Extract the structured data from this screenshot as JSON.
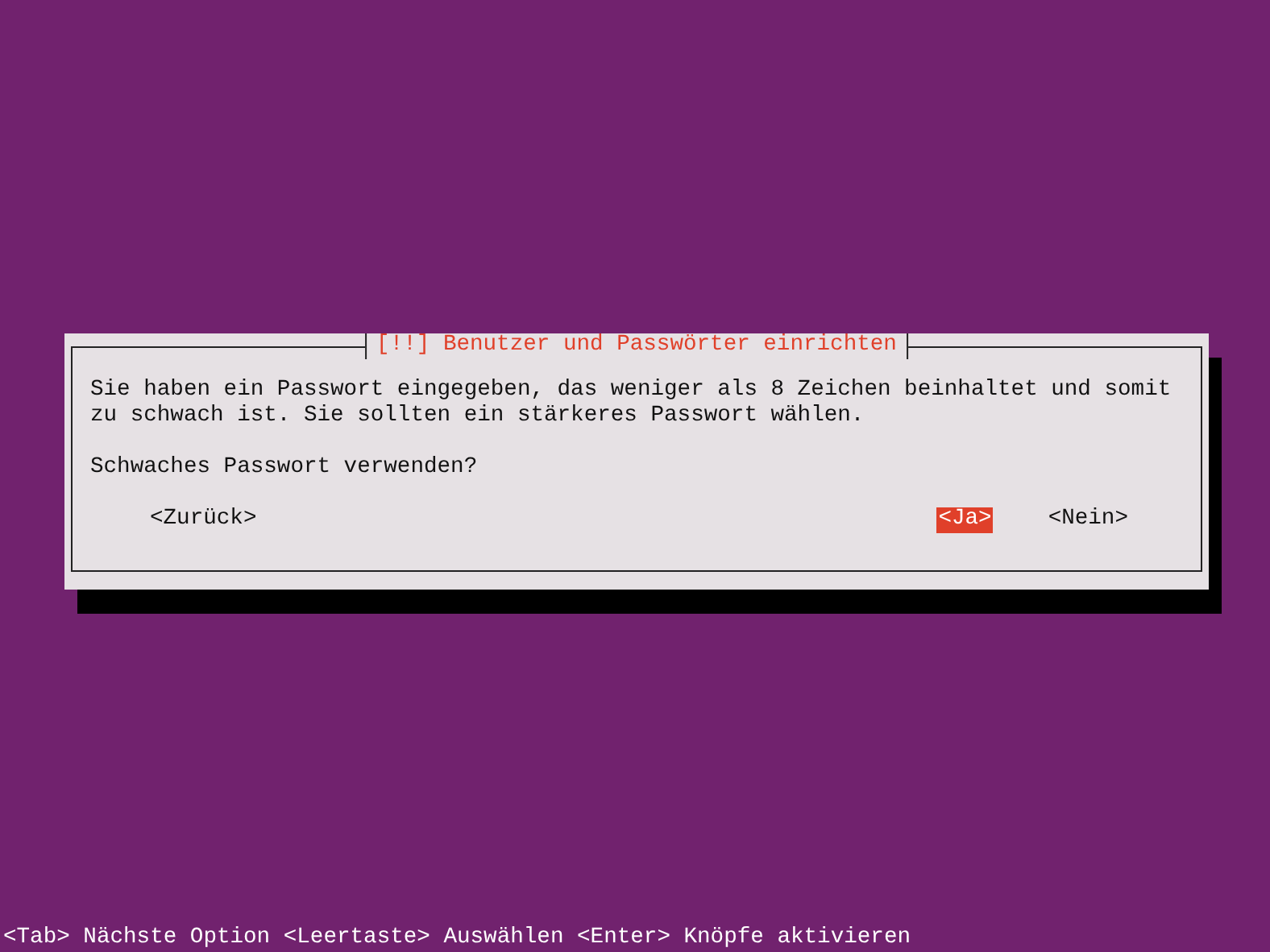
{
  "dialog": {
    "title": "[!!] Benutzer und Passwörter einrichten",
    "message": "Sie haben ein Passwort eingegeben, das weniger als 8 Zeichen beinhaltet und somit zu schwach ist. Sie sollten ein stärkeres Passwort wählen.",
    "question": "Schwaches Passwort verwenden?",
    "buttons": [
      {
        "label": "<Zurück>",
        "selected": false
      },
      {
        "label": "<Ja>",
        "selected": true
      },
      {
        "label": "<Nein>",
        "selected": false
      }
    ]
  },
  "status_bar": "<Tab> Nächste Option <Leertaste> Auswählen <Enter> Knöpfe aktivieren"
}
